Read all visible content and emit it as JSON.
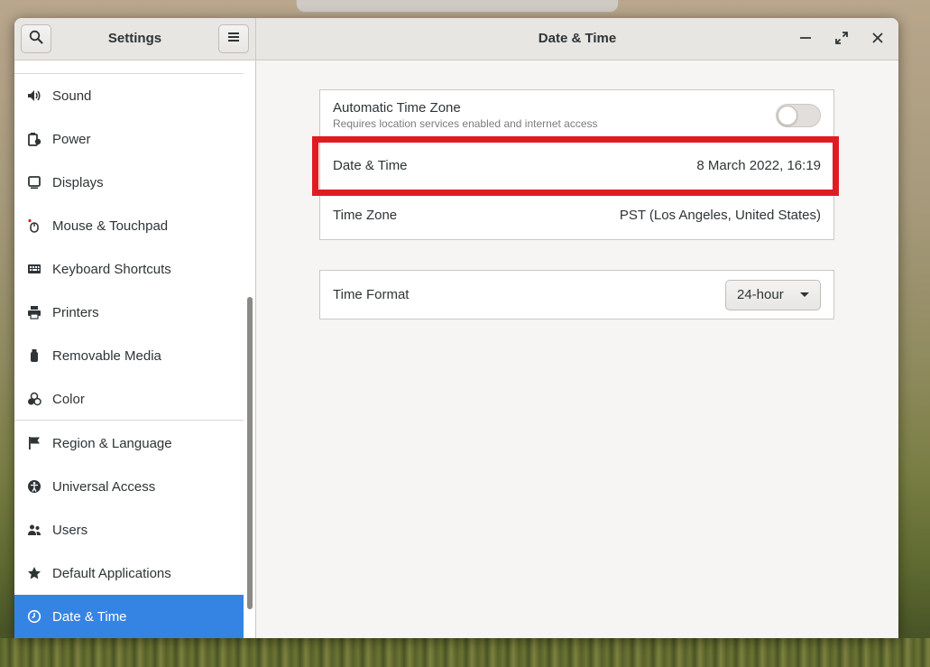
{
  "window": {
    "sidebar_title": "Settings",
    "main_title": "Date & Time"
  },
  "sidebar": {
    "items": [
      {
        "label": "Sound",
        "icon": "speaker-icon"
      },
      {
        "label": "Power",
        "icon": "battery-icon"
      },
      {
        "label": "Displays",
        "icon": "monitor-icon"
      },
      {
        "label": "Mouse & Touchpad",
        "icon": "mouse-icon"
      },
      {
        "label": "Keyboard Shortcuts",
        "icon": "keyboard-icon"
      },
      {
        "label": "Printers",
        "icon": "printer-icon"
      },
      {
        "label": "Removable Media",
        "icon": "usb-icon"
      },
      {
        "label": "Color",
        "icon": "color-circles-icon"
      },
      {
        "label": "Region & Language",
        "icon": "flag-icon"
      },
      {
        "label": "Universal Access",
        "icon": "accessibility-icon"
      },
      {
        "label": "Users",
        "icon": "users-icon"
      },
      {
        "label": "Default Applications",
        "icon": "star-icon"
      },
      {
        "label": "Date & Time",
        "icon": "clock-icon",
        "active": true
      }
    ]
  },
  "datetime": {
    "auto_tz_label": "Automatic Time Zone",
    "auto_tz_sub": "Requires location services enabled and internet access",
    "auto_tz_enabled": false,
    "date_time_label": "Date & Time",
    "date_time_value": "8 March 2022, 16:19",
    "time_zone_label": "Time Zone",
    "time_zone_value": "PST (Los Angeles, United States)",
    "time_format_label": "Time Format",
    "time_format_value": "24-hour"
  },
  "colors": {
    "accent": "#3584e4",
    "highlight": "#e01b24"
  }
}
